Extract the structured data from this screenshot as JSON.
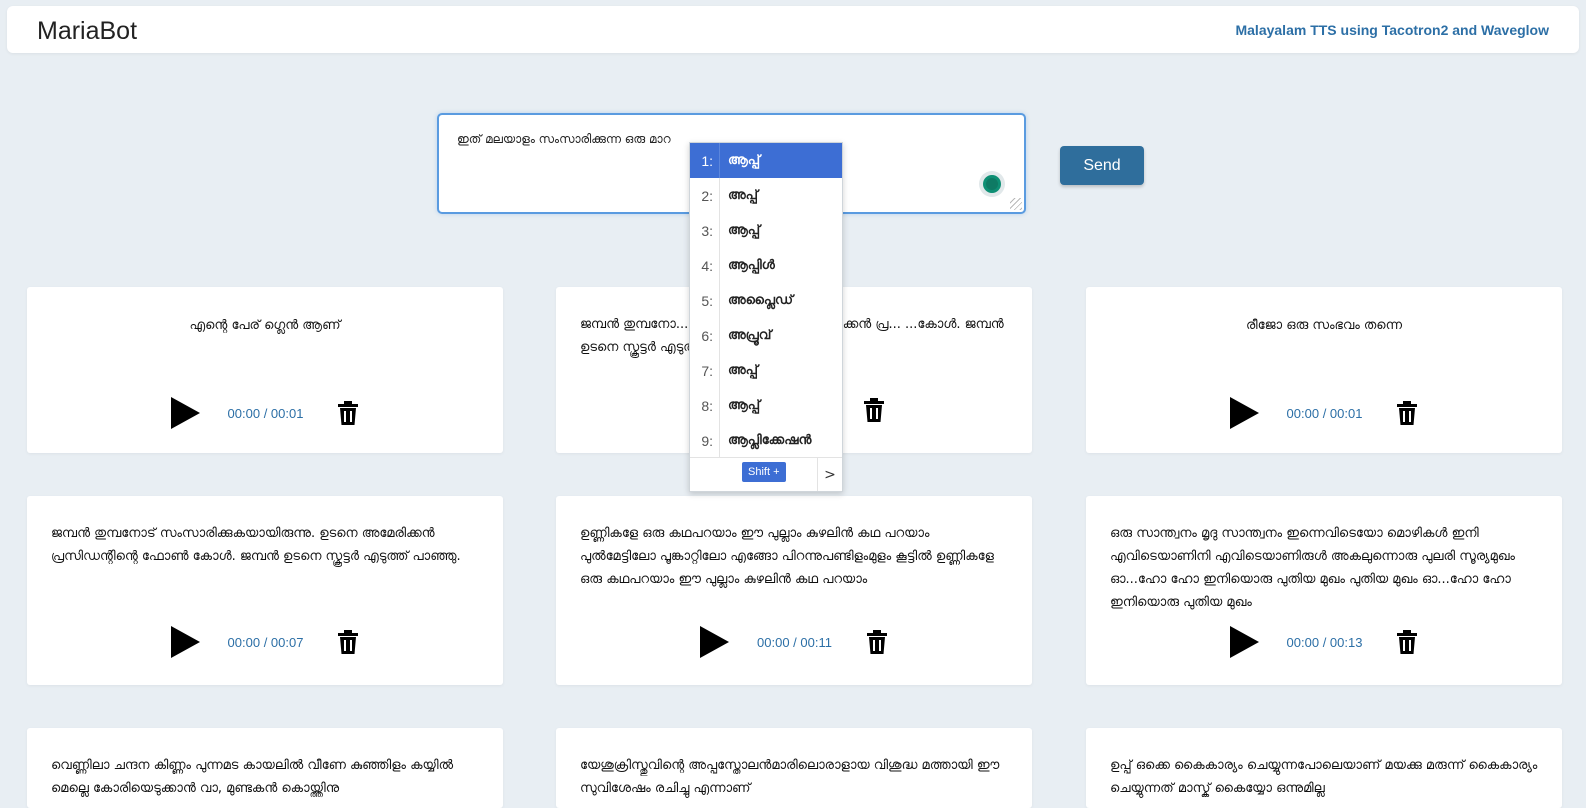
{
  "app": {
    "brand": "MariaBot",
    "subtitle": "Malayalam TTS using Tacotron2 and Waveglow"
  },
  "composer": {
    "text": "ഇത് മലയാളം സംസാരിക്കുന്ന ഒരു മാറ",
    "send_label": "Send"
  },
  "suggestions": {
    "items": [
      {
        "num": "1:",
        "word": "ആപ്പ്"
      },
      {
        "num": "2:",
        "word": "അപ്പ്"
      },
      {
        "num": "3:",
        "word": "ആപ്പ്"
      },
      {
        "num": "4:",
        "word": "ആപ്പിൾ"
      },
      {
        "num": "5:",
        "word": "അപ്ലൈഡ്"
      },
      {
        "num": "6:",
        "word": "അപ്രൂവ്"
      },
      {
        "num": "7:",
        "word": "അപ്പ്"
      },
      {
        "num": "8:",
        "word": "ആപ്പ്"
      },
      {
        "num": "9:",
        "word": "ആപ്ലിക്കേഷൻ"
      }
    ],
    "shift_label": "Shift +",
    "next_label": ">"
  },
  "cards": [
    {
      "text": "എന്റെ പേര് ഗ്ലെൻ ആണ്",
      "time": "00:00 / 00:01"
    },
    {
      "text": "ജമ്പൻ തുമ്പനോ... ...ിരുന്നു. ഉടനെ അമേരിക്കൻ പ്ര... ...കോൾ. ജമ്പൻ ഉടനെ സ്കൂട്ടർ എടുത്ത...",
      "time": ""
    },
    {
      "text": "രീജോ ഒരു സംഭവം തന്നെ",
      "time": "00:00 / 00:01"
    },
    {
      "text": "ജമ്പൻ തുമ്പനോട് സംസാരിക്കുകയായിരുന്നു. ഉടനെ അമേരിക്കൻ പ്രസിഡന്റിന്റെ ഫോൺ കോൾ. ജമ്പൻ ഉടനെ സ്കൂട്ടർ എടുത്ത് പാഞ്ഞു.",
      "time": "00:00 / 00:07"
    },
    {
      "text": "ഉണ്ണികളേ ഒരു കഥപറയാം ഈ പുല്ലാം കുഴലിൻ കഥ പറയാം പുൽമേട്ടിലോ പൂങ്കാറ്റിലോ എങ്ങോ പിറന്നുപണ്ടിളംമുളം കൂട്ടിൽ ഉണ്ണികളേ ഒരു കഥപറയാം ഈ പുല്ലാം കുഴലിൻ കഥ പറയാം",
      "time": "00:00 / 00:11"
    },
    {
      "text": "ഒരു സാന്ത്വനം മൃദു സാന്ത്വനം ഇന്നെവിടെയോ മൊഴികൾ ഇനി എവിടെയാണിനി എവിടെയാണിരുൾ അകലുന്നൊരു പുലരി സൂര്യമുഖം ഓ...ഹോ ഹോ ഇനിയൊരു പുതിയ മുഖം പുതിയ മുഖം ഓ...ഹോ ഹോ ഇനിയൊരു പുതിയ മുഖം",
      "time": "00:00 / 00:13"
    },
    {
      "text": "വെണ്ണിലാ ചന്ദന കിണ്ണം പുന്നമട കായലിൽ വീണേ കുഞ്ഞിളം കയ്യിൽ മെല്ലെ കോരിയെടുക്കാൻ വാ, മുണ്ടകൻ കൊയ്ത്തിനു",
      "time": ""
    },
    {
      "text": "യേശുക്രിസ്തുവിന്റെ അപ്പസ്തോലൻമാരിലൊരാളായ വിശുദ്ധ മത്തായി ഈ സുവിശേഷം രചിച്ചു എന്നാണ്",
      "time": ""
    },
    {
      "text": "ഉപ്പ് ഒക്കെ കൈകാര്യം ചെയ്യുന്നപോലെയാണ് മയക്കു മരുന്ന് കൈകാര്യം ചെയ്യുന്നത് മാസ്ക് കൈയ്യോ ഒന്നുമില്ല",
      "time": ""
    }
  ]
}
